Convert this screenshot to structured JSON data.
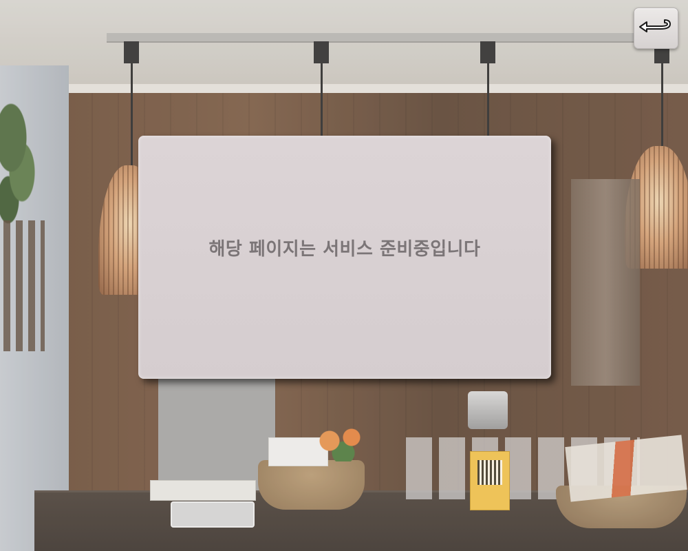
{
  "background": {
    "description_icon": "cafe-interior-photo"
  },
  "toolbar": {
    "back_icon": "return-arrow-icon"
  },
  "notice": {
    "message": "해당 페이지는 서비스 준비중입니다"
  },
  "colors": {
    "card_bg": "#d9d1d3",
    "message_text": "#7b7577",
    "button_bg": "#e2dfde"
  }
}
